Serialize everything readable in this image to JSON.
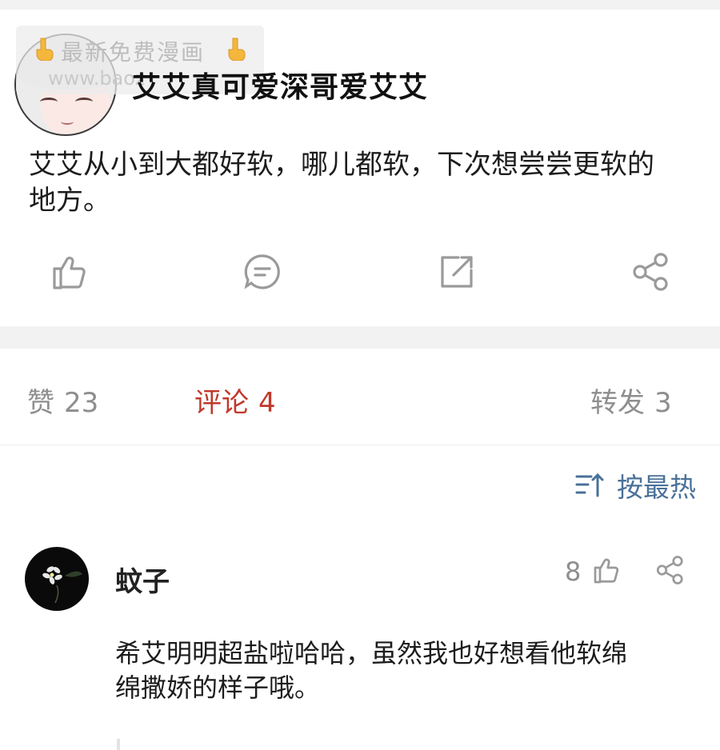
{
  "watermark": {
    "line1": "最新免费漫画",
    "line2": "www.baoz"
  },
  "post": {
    "author": "艾艾真可爱深哥爱艾艾",
    "text": "艾艾从小到大都好软，哪儿都软，下次想尝尝更软的地方。",
    "actions": [
      {
        "icon": "thumbs-up-icon"
      },
      {
        "icon": "comment-icon"
      },
      {
        "icon": "repost-icon"
      },
      {
        "icon": "share-icon"
      }
    ]
  },
  "stats": {
    "likes_label": "赞",
    "likes_count": "23",
    "comments_label": "评论",
    "comments_count": "4",
    "reposts_label": "转发",
    "reposts_count": "3"
  },
  "sort": {
    "label": "按最热"
  },
  "comments": [
    {
      "author": "蚊子",
      "likes": "8",
      "text": "希艾明明超盐啦哈哈，虽然我也好想看他软绵绵撒娇的样子哦。"
    }
  ],
  "colors": {
    "accent_red": "#c0392b",
    "link_blue": "#4a7199",
    "muted": "#8e8e8e",
    "divider": "#f2f2f2"
  }
}
